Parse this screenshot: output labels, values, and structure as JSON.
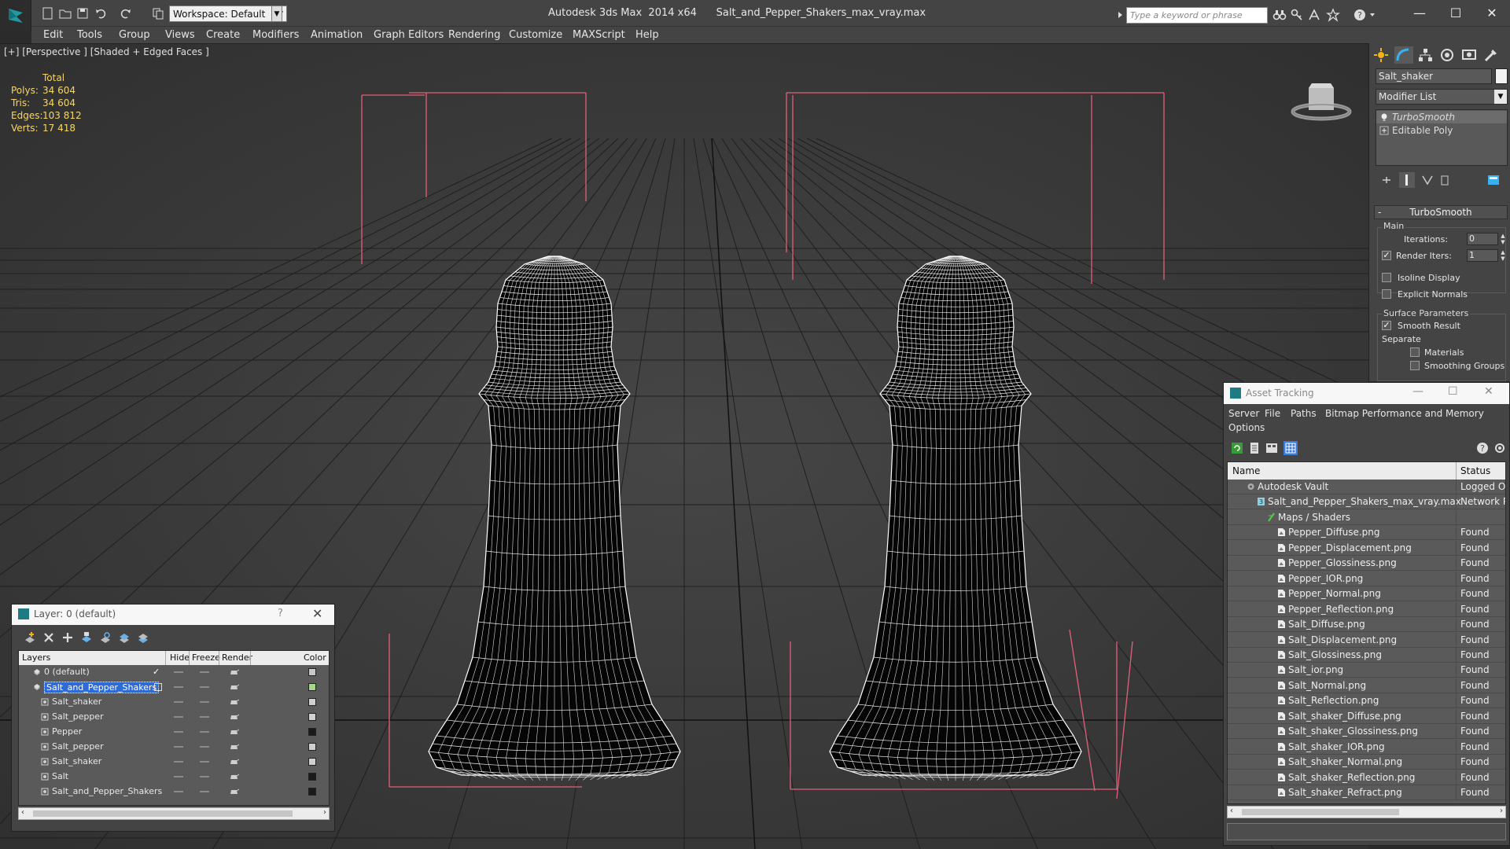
{
  "titlebar": {
    "workspace": "Workspace: Default",
    "app_title": "Autodesk 3ds Max  2014 x64      Salt_and_Pepper_Shakers_max_vray.max",
    "search_placeholder": "Type a keyword or phrase"
  },
  "menu": [
    "Edit",
    "Tools",
    "Group",
    "Views",
    "Create",
    "Modifiers",
    "Animation",
    "Graph Editors",
    "Rendering",
    "Customize",
    "MAXScript",
    "Help"
  ],
  "viewport": {
    "label": "[+] [Perspective ] [Shaded + Edged Faces ]",
    "stats": {
      "header": "Total",
      "rows": [
        {
          "k": "Polys:",
          "v": "34 604"
        },
        {
          "k": "Tris:",
          "v": "34 604"
        },
        {
          "k": "Edges:",
          "v": "103 812"
        },
        {
          "k": "Verts:",
          "v": "17 418"
        }
      ]
    }
  },
  "command_panel": {
    "object_name": "Salt_shaker",
    "modifier_list": "Modifier List",
    "stack": [
      "TurboSmooth",
      "Editable Poly"
    ],
    "rollout": "TurboSmooth",
    "main_group": "Main",
    "iterations_label": "Iterations:",
    "iterations_value": "0",
    "render_iters_label": "Render Iters:",
    "render_iters_value": "1",
    "isoline": "Isoline Display",
    "explicit_normals": "Explicit Normals",
    "surface_group": "Surface Parameters",
    "smooth_result": "Smooth Result",
    "separate": "Separate",
    "materials": "Materials",
    "smoothing_groups": "Smoothing Groups"
  },
  "layer_dialog": {
    "title": "Layer: 0 (default)",
    "help": "?",
    "columns": [
      "Layers",
      "Hide",
      "Freeze",
      "Render",
      "Color"
    ],
    "rows": [
      {
        "name": "0 (default)",
        "indent": 0,
        "type": "layer",
        "color": "#c8c8c8",
        "active": true
      },
      {
        "name": "Salt_and_Pepper_Shakers",
        "indent": 0,
        "type": "layer",
        "color": "#a5d68a",
        "selected": true
      },
      {
        "name": "Salt_shaker",
        "indent": 1,
        "type": "object",
        "color": "#d0d0d0"
      },
      {
        "name": "Salt_pepper",
        "indent": 1,
        "type": "object",
        "color": "#d0d0d0"
      },
      {
        "name": "Pepper",
        "indent": 1,
        "type": "object",
        "color": "#1a1a1a"
      },
      {
        "name": "Salt_pepper",
        "indent": 1,
        "type": "object",
        "color": "#d0d0d0"
      },
      {
        "name": "Salt_shaker",
        "indent": 1,
        "type": "object",
        "color": "#d0d0d0"
      },
      {
        "name": "Salt",
        "indent": 1,
        "type": "object",
        "color": "#1a1a1a"
      },
      {
        "name": "Salt_and_Pepper_Shakers",
        "indent": 1,
        "type": "object",
        "color": "#1a1a1a"
      }
    ]
  },
  "asset_dialog": {
    "title": "Asset Tracking",
    "menu": [
      "Server",
      "File",
      "Paths",
      "Bitmap Performance and Memory",
      "Options"
    ],
    "columns": [
      "Name",
      "Status"
    ],
    "rows": [
      {
        "name": "Autodesk Vault",
        "status": "Logged Ou",
        "indent": 0,
        "icon": "vault"
      },
      {
        "name": "Salt_and_Pepper_Shakers_max_vray.max",
        "status": "Network P",
        "indent": 1,
        "icon": "max"
      },
      {
        "name": "Maps / Shaders",
        "status": "",
        "indent": 2,
        "icon": "maps"
      },
      {
        "name": "Pepper_Diffuse.png",
        "status": "Found",
        "indent": 3,
        "icon": "file"
      },
      {
        "name": "Pepper_Displacement.png",
        "status": "Found",
        "indent": 3,
        "icon": "file"
      },
      {
        "name": "Pepper_Glossiness.png",
        "status": "Found",
        "indent": 3,
        "icon": "file"
      },
      {
        "name": "Pepper_IOR.png",
        "status": "Found",
        "indent": 3,
        "icon": "file"
      },
      {
        "name": "Pepper_Normal.png",
        "status": "Found",
        "indent": 3,
        "icon": "file"
      },
      {
        "name": "Pepper_Reflection.png",
        "status": "Found",
        "indent": 3,
        "icon": "file"
      },
      {
        "name": "Salt_Diffuse.png",
        "status": "Found",
        "indent": 3,
        "icon": "file"
      },
      {
        "name": "Salt_Displacement.png",
        "status": "Found",
        "indent": 3,
        "icon": "file"
      },
      {
        "name": "Salt_Glossiness.png",
        "status": "Found",
        "indent": 3,
        "icon": "file"
      },
      {
        "name": "Salt_ior.png",
        "status": "Found",
        "indent": 3,
        "icon": "file"
      },
      {
        "name": "Salt_Normal.png",
        "status": "Found",
        "indent": 3,
        "icon": "file"
      },
      {
        "name": "Salt_Reflection.png",
        "status": "Found",
        "indent": 3,
        "icon": "file"
      },
      {
        "name": "Salt_shaker_Diffuse.png",
        "status": "Found",
        "indent": 3,
        "icon": "file"
      },
      {
        "name": "Salt_shaker_Glossiness.png",
        "status": "Found",
        "indent": 3,
        "icon": "file"
      },
      {
        "name": "Salt_shaker_IOR.png",
        "status": "Found",
        "indent": 3,
        "icon": "file"
      },
      {
        "name": "Salt_shaker_Normal.png",
        "status": "Found",
        "indent": 3,
        "icon": "file"
      },
      {
        "name": "Salt_shaker_Reflection.png",
        "status": "Found",
        "indent": 3,
        "icon": "file"
      },
      {
        "name": "Salt_shaker_Refract.png",
        "status": "Found",
        "indent": 3,
        "icon": "file"
      }
    ]
  },
  "colors": {
    "stats_text": "#f5d76e",
    "selection": "#2f6bd6",
    "wire": "#ffffff",
    "bbox": "#e0627a"
  }
}
